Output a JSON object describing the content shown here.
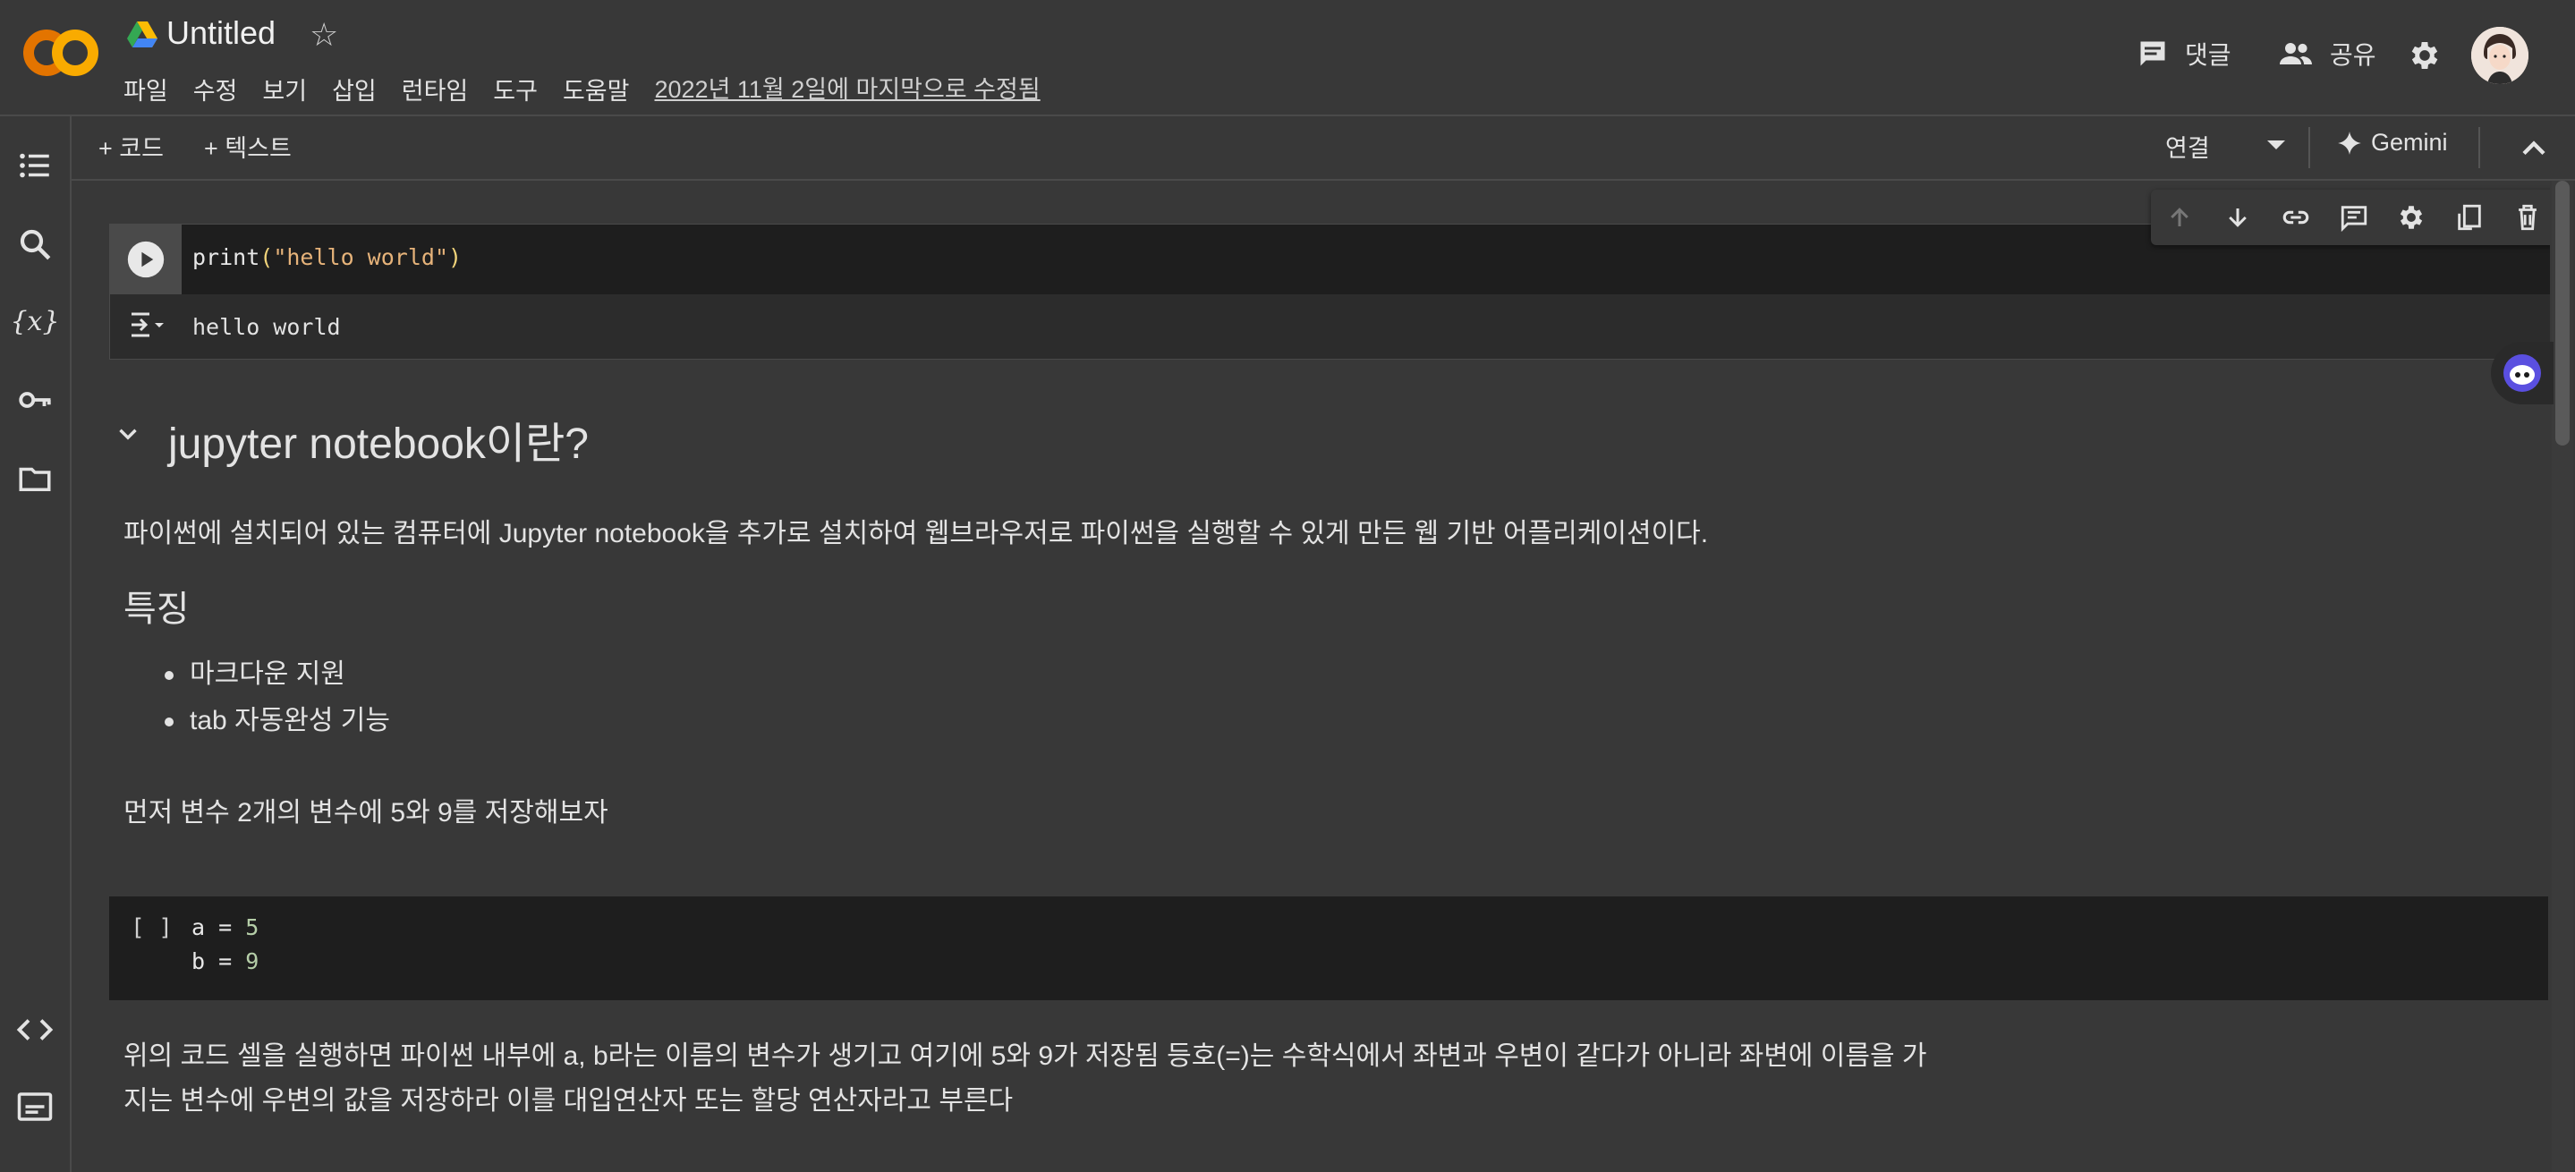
{
  "header": {
    "title": "Untitled",
    "menu": [
      "파일",
      "수정",
      "보기",
      "삽입",
      "런타임",
      "도구",
      "도움말"
    ],
    "last_edit": "2022년 11월 2일에 마지막으로 수정됨",
    "comment_label": "댓글",
    "share_label": "공유"
  },
  "toolbar": {
    "add_code": "+ 코드",
    "add_text": "+ 텍스트",
    "connect": "연결",
    "gemini": "Gemini"
  },
  "cells": {
    "code1": {
      "fn": "print",
      "open": "(",
      "str": "\"hello world\"",
      "close": ")",
      "output": "hello world"
    },
    "heading": "jupyter notebook이란?",
    "para1": "파이썬에 설치되어 있는 컴퓨터에 Jupyter notebook을 추가로 설치하여 웹브라우저로 파이썬을 실행할 수 있게 만든 웹 기반 어플리케이션이다.",
    "subheading": "특징",
    "features": [
      "마크다운 지원",
      "tab 자동완성 기능"
    ],
    "para2": "먼저 변수 2개의 변수에 5와 9를 저장해보자",
    "code2": {
      "bracket": "[ ]",
      "line1_var": "a = ",
      "line1_val": "5",
      "line2_var": "b = ",
      "line2_val": "9"
    },
    "para3_line1": "위의 코드 셀을 실행하면 파이썬 내부에 a, b라는 이름의 변수가 생기고 여기에 5와 9가 저장됨 등호(=)는 수학식에서 좌변과 우변이 같다가 아니라 좌변에 이름을 가",
    "para3_line2": "지는 변수에 우변의 값을 저장하라 이를 대입연산자 또는 할당 연산자라고 부른다"
  },
  "icons": {
    "logo": "colab-logo",
    "drive": "google-drive-icon",
    "colors": {
      "logo_orange": "#f9ab00",
      "logo_dark": "#e37400"
    }
  }
}
